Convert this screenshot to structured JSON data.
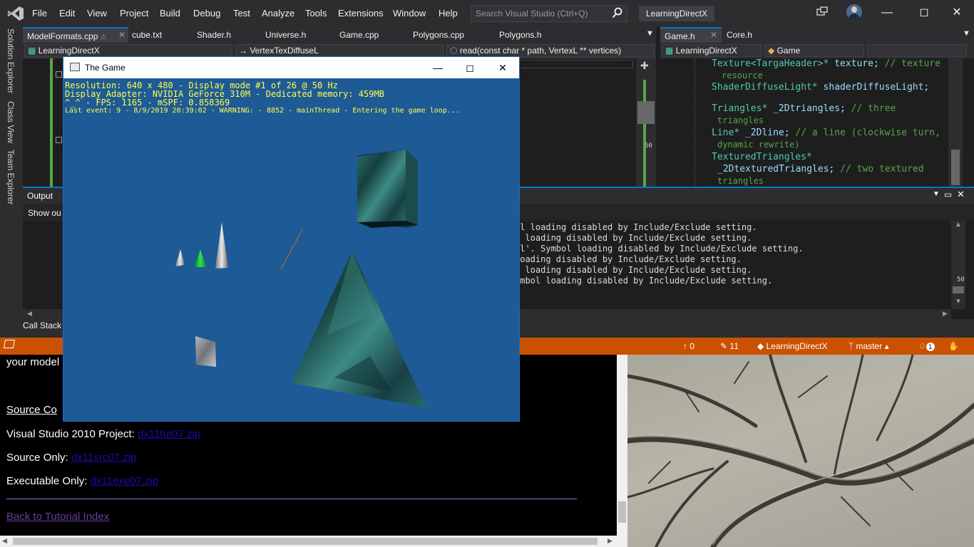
{
  "menubar": {
    "items": [
      "File",
      "Edit",
      "View",
      "Project",
      "Build",
      "Debug",
      "Test",
      "Analyze",
      "Tools",
      "Extensions",
      "Window",
      "Help"
    ],
    "search_placeholder": "Search Visual Studio (Ctrl+Q)",
    "solution_name": "LearningDirectX"
  },
  "side_tabs": [
    "Solution Explorer",
    "Class View",
    "Team Explorer"
  ],
  "editor_tabs_left": [
    "ModelFormats.cpp",
    "cube.txt",
    "Shader.h",
    "Universe.h",
    "Game.cpp",
    "Polygons.cpp",
    "Polygons.h"
  ],
  "editor_tabs_right": [
    "Game.h",
    "Core.h"
  ],
  "navbar_left": {
    "project": "LearningDirectX",
    "scope": "VertexTexDiffuseL",
    "member": "read(const char * path, VertexL ** vertices)"
  },
  "navbar_right": {
    "project": "LearningDirectX",
    "scope": "Game"
  },
  "code_right": {
    "l1_type": "Texture<TargaHeader>*",
    "l1_var": " texture;",
    "l1_comment": " // texture",
    "l2_comment": "resource",
    "l3_type": "ShaderDiffuseLight*",
    "l3_var": " shaderDiffuseLight;",
    "l4_type": "Triangles*",
    "l4_var": " _2Dtriangles;",
    "l4_comment": " // three",
    "l5_comment": "triangles",
    "l6_type": "Line*",
    "l6_var": " _2Dline;",
    "l6_comment": " // a line (clockwise turn,",
    "l7_comment": "dynamic rewrite)",
    "l8_type": "TexturedTriangles*",
    "l9_var": "_2DtexturedTriangles;",
    "l9_comment": " // two textured",
    "l10_comment": "triangles"
  },
  "output": {
    "title": "Output",
    "show_output_from": "Show ou",
    "lines": [
      "ol loading disabled by Include/Exclude setting.",
      ". loading disabled by Include/Exclude setting.",
      "ll'. Symbol loading disabled by Include/Exclude setting.",
      " loading disabled by Include/Exclude setting.",
      ". loading disabled by Include/Exclude setting.",
      "ymbol loading disabled by Include/Exclude setting."
    ],
    "scroll_marker": "50"
  },
  "editor_scroll_marker": "50",
  "callstack_label": "Call Stack",
  "statusbar": {
    "up_count": "0",
    "pencil_count": "11",
    "project": "LearningDirectX",
    "branch": "master",
    "notifications": "1"
  },
  "webpage": {
    "line1": "your model",
    "source_heading": "Source Co",
    "vs_label": "Visual Studio 2010 Project: ",
    "vs_link": "dx11tut07.zip",
    "src_label": "Source Only: ",
    "src_link": "dx11src07.zip",
    "exe_label": "Executable Only: ",
    "exe_link": "dx11exe07.zip",
    "back_link": "Back to Tutorial Index"
  },
  "game": {
    "title": "The Game",
    "hud": [
      "Resolution: 640 x 480 - Display mode #1 of 26 @ 50 Hz",
      "Display Adapter: NVIDIA GeForce 310M - Dedicated memory: 459MB",
      "^_^ - FPS: 1165 - mSPF: 0.858369",
      "Last event: 9 - 8/9/2019 20:39:02 - WARNING: - 8852 - mainThread - Entering the game loop..."
    ]
  }
}
